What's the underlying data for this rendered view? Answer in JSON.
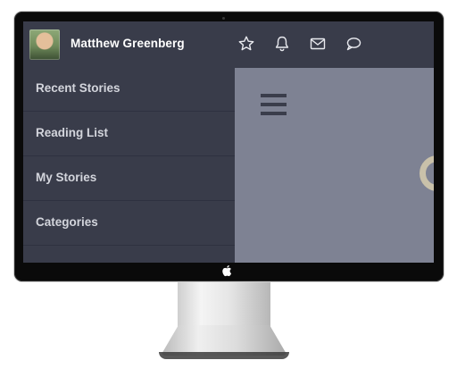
{
  "header": {
    "user_name": "Matthew Greenberg",
    "icons": [
      "star-icon",
      "bell-icon",
      "mail-icon",
      "chat-bubble-icon"
    ]
  },
  "sidebar": {
    "items": [
      {
        "label": "Recent Stories"
      },
      {
        "label": "Reading List"
      },
      {
        "label": "My Stories"
      },
      {
        "label": "Categories"
      }
    ]
  },
  "content": {
    "menu_icon": "hamburger-menu-icon"
  },
  "colors": {
    "sidebar_bg": "#393c4a",
    "content_bg": "#7e8293",
    "text_light": "#d3d5dc",
    "ring": "#c9c1aa"
  }
}
